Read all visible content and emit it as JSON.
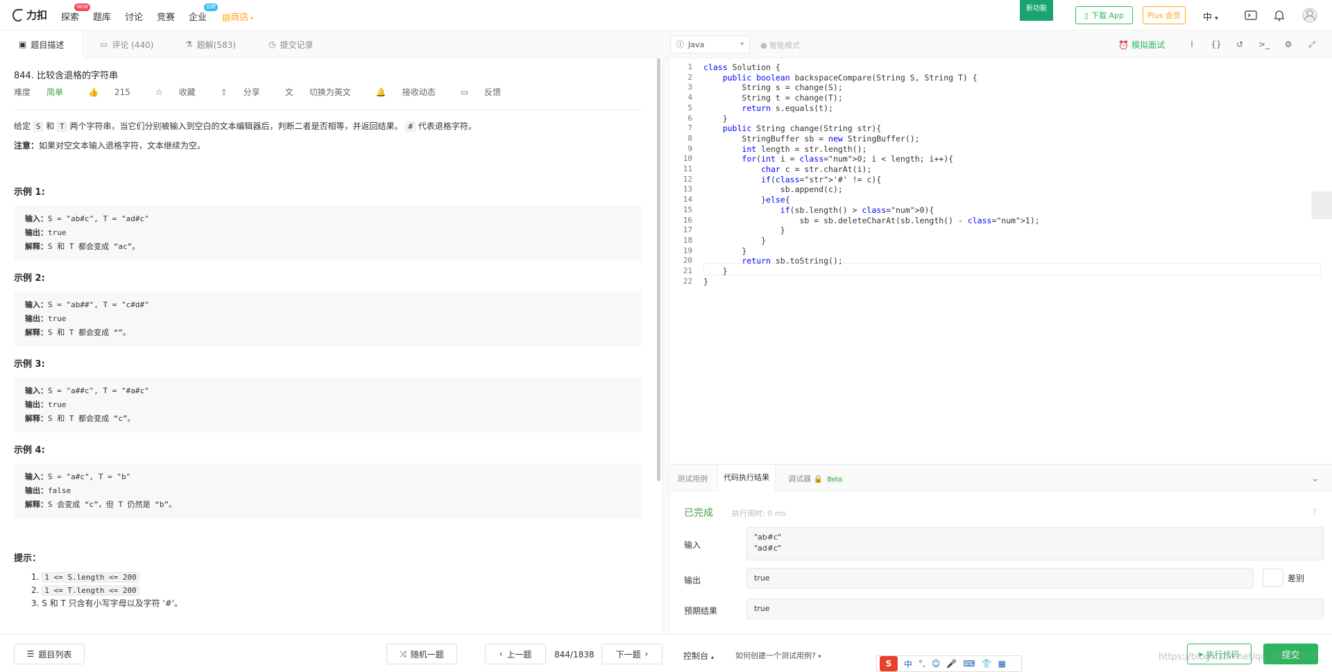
{
  "nav": {
    "logo": "力扣",
    "items": [
      {
        "label": "探索",
        "badge": "NEW"
      },
      {
        "label": "题库"
      },
      {
        "label": "讨论"
      },
      {
        "label": "竞赛"
      },
      {
        "label": "企业",
        "badge": "招聘"
      },
      {
        "label": "商店"
      }
    ],
    "new_feature": "新功能",
    "download_app": "下载 App",
    "plus": "Plus 会员",
    "language": "中"
  },
  "left_tabs": [
    {
      "label": "题目描述",
      "icon": "description-icon"
    },
    {
      "label": "评论 (440)",
      "icon": "comment-icon"
    },
    {
      "label": "题解(583)",
      "icon": "flask-icon"
    },
    {
      "label": "提交记录",
      "icon": "clock-icon"
    }
  ],
  "editor_toolbar": {
    "language": "Java",
    "smart_mode": "智能模式",
    "mock_interview": "模拟面试"
  },
  "problem": {
    "title": "844. 比较含退格的字符串",
    "difficulty_label": "难度",
    "difficulty": "简单",
    "likes": "215",
    "collect": "收藏",
    "share": "分享",
    "switch_en": "切换为英文",
    "subscribe": "接收动态",
    "feedback": "反馈",
    "desc_pre": "给定 ",
    "desc_s": "S",
    "desc_and": " 和 ",
    "desc_t": "T",
    "desc_post": " 两个字符串，当它们分别被输入到空白的文本编辑器后，判断二者是否相等，并返回结果。 ",
    "desc_hash": "#",
    "desc_tail": " 代表退格字符。",
    "note_label": "注意：",
    "note": "如果对空文本输入退格字符，文本继续为空。",
    "examples": [
      {
        "title": "示例 1:",
        "input": "S = \"ab#c\", T = \"ad#c\"",
        "output": "true",
        "explain": "S 和 T 都会变成 “ac”。"
      },
      {
        "title": "示例 2:",
        "input": "S = \"ab##\", T = \"c#d#\"",
        "output": "true",
        "explain": "S 和 T 都会变成 “”。"
      },
      {
        "title": "示例 3:",
        "input": "S = \"a##c\", T = \"#a#c\"",
        "output": "true",
        "explain": "S 和 T 都会变成 “c”。"
      },
      {
        "title": "示例 4:",
        "input": "S = \"a#c\", T = \"b\"",
        "output": "false",
        "explain": "S 会变成 “c”，但 T 仍然是 “b”。"
      }
    ],
    "input_label": "输入：",
    "output_label": "输出：",
    "explain_label": "解释：",
    "hints_title": "提示：",
    "hints": [
      {
        "num": "1.",
        "code": "1 <= S.length <= 200",
        "text": ""
      },
      {
        "num": "2.",
        "code": "1 <= T.length <= 200",
        "text": ""
      },
      {
        "num": "3.",
        "code": "",
        "text": "S 和 T 只含有小写字母以及字符 '#'。"
      }
    ]
  },
  "code_lines": [
    "class Solution {",
    "    public boolean backspaceCompare(String S, String T) {",
    "        String s = change(S);",
    "        String t = change(T);",
    "        return s.equals(t);",
    "    }",
    "    public String change(String str){",
    "        StringBuffer sb = new StringBuffer();",
    "        int length = str.length();",
    "        for(int i = 0; i < length; i++){",
    "            char c = str.charAt(i);",
    "            if('#' != c){",
    "                sb.append(c);",
    "            }else{",
    "                if(sb.length() > 0){",
    "                    sb = sb.deleteCharAt(sb.length() - 1);",
    "                }",
    "            }",
    "        }",
    "        return sb.toString();",
    "    }",
    "}"
  ],
  "console": {
    "tabs": [
      "测试用例",
      "代码执行结果",
      "调试器",
      "Beta"
    ],
    "status": "已完成",
    "runtime": "执行用时: 0 ms",
    "input_label": "输入",
    "input_lines": [
      "\"ab#c\"",
      "\"ad#c\""
    ],
    "output_label": "输出",
    "output": "true",
    "diff_label": "差别",
    "expected_label": "预期结果",
    "expected": "true"
  },
  "bottom": {
    "problem_list": "题目列表",
    "random": "随机一题",
    "prev": "上一题",
    "page": "844/1838",
    "next": "下一题",
    "console": "控制台",
    "howto": "如何创建一个测试用例?",
    "run": "执行代码",
    "submit": "提交"
  },
  "ime": {
    "logo": "S",
    "mode": "中",
    "punct": "°,"
  },
  "watermark": "https://blog.csdn.net/qq_38441377"
}
